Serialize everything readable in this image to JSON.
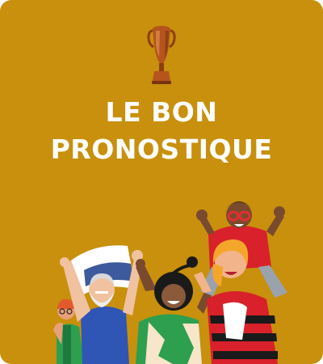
{
  "card": {
    "background_color": "#C8900C",
    "title_line1": "LE BON",
    "title_line2": "PRONOSTIQUE",
    "trophy_icon": "trophy-icon",
    "illustration": "celebrating-fans-illustration"
  }
}
